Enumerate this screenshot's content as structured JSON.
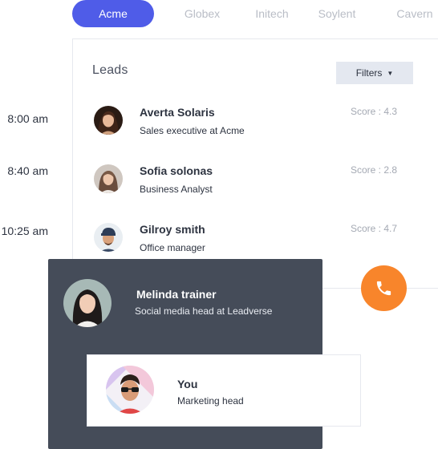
{
  "tabs": [
    {
      "label": "Acme",
      "active": true
    },
    {
      "label": "Globex",
      "active": false
    },
    {
      "label": "Initech",
      "active": false
    },
    {
      "label": "Soylent",
      "active": false
    },
    {
      "label": "Cavern",
      "active": false
    }
  ],
  "timeline": {
    "times": [
      "8:00 am",
      "8:40 am",
      "10:25 am"
    ]
  },
  "leads": {
    "title": "Leads",
    "filters_label": "Filters",
    "items": [
      {
        "name": "Averta Solaris",
        "role": "Sales executive at Acme",
        "score": "Score : 4.3"
      },
      {
        "name": "Sofia solonas",
        "role": "Business Analyst",
        "score": "Score : 2.8"
      },
      {
        "name": "Gilroy smith",
        "role": "Office manager",
        "score": "Score : 4.7"
      }
    ]
  },
  "call": {
    "caller_name": "Melinda trainer",
    "caller_role": "Social media head at Leadverse",
    "icon": "phone-icon"
  },
  "you": {
    "name": "You",
    "role": "Marketing head"
  },
  "colors": {
    "accent": "#4f5ce8",
    "call_button": "#f8852b",
    "panel": "#454c59",
    "filters_bg": "#e4e8f0"
  }
}
